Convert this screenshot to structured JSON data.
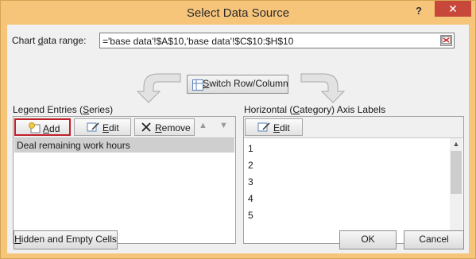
{
  "window": {
    "title": "Select Data Source",
    "help_glyph": "?",
    "close_glyph": "✕"
  },
  "range": {
    "label_pre": "Chart ",
    "label_key": "d",
    "label_post": "ata range:",
    "value": "='base data'!$A$10,'base data'!$C$10:$H$10"
  },
  "switch": {
    "label_pre": "S",
    "label_key": "w",
    "label_post": "itch Row/Column"
  },
  "legend": {
    "title_pre": "Legend Entries (",
    "title_key": "S",
    "title_post": "eries)",
    "add": {
      "key": "A",
      "rest": "dd"
    },
    "edit": {
      "key": "E",
      "rest": "dit"
    },
    "remove": {
      "key": "R",
      "rest": "emove"
    },
    "up_glyph": "▲",
    "down_glyph": "▼",
    "items": [
      "Deal remaining work hours"
    ]
  },
  "axis": {
    "title_pre": "Horizontal (",
    "title_key": "C",
    "title_post": "ategory) Axis Labels",
    "edit": {
      "key": "E",
      "rest": "dit"
    },
    "items": [
      "1",
      "2",
      "3",
      "4",
      "5"
    ]
  },
  "footer": {
    "hidden_key": "H",
    "hidden_rest": "idden and Empty Cells",
    "ok": "OK",
    "cancel": "Cancel"
  },
  "colors": {
    "accent": "#f7c57a",
    "close": "#c7473a",
    "highlight": "#c0202a"
  }
}
